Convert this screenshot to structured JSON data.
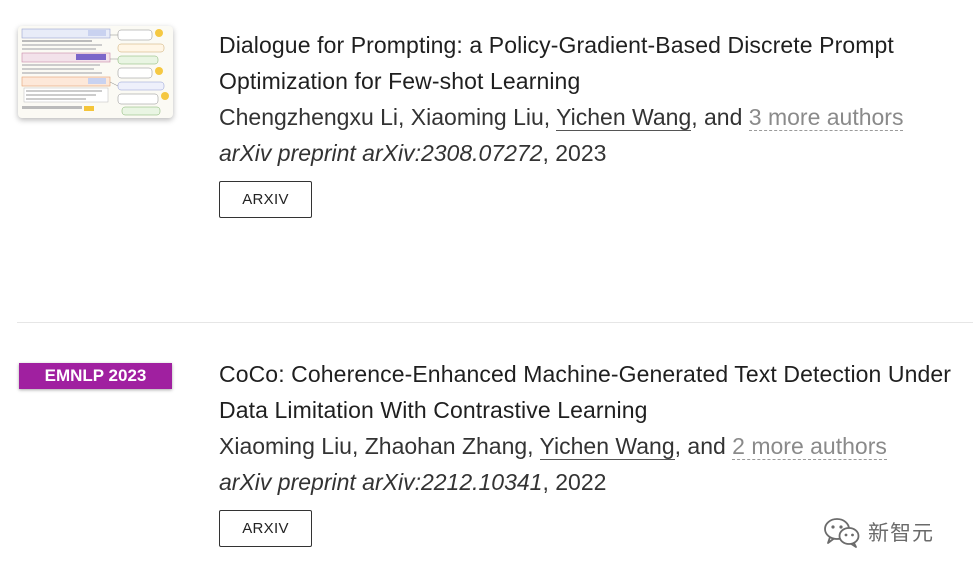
{
  "publications": [
    {
      "title": "Dialogue for Prompting: a Policy-Gradient-Based Discrete Prompt Optimization for Few-shot Learning",
      "authors_lead": "Chengzhengxu Li, Xiaoming Liu, ",
      "author_self": "Yichen Wang",
      "authors_and": ", and ",
      "more_authors": "3 more authors",
      "venue": "arXiv preprint arXiv:2308.07272",
      "year_suffix": ", 2023",
      "link_label": "ARXIV",
      "has_thumbnail": true
    },
    {
      "badge": "EMNLP 2023",
      "badge_color": "#a020a0",
      "title": "CoCo: Coherence-Enhanced Machine-Generated Text Detection Under Data Limitation With Contrastive Learning",
      "authors_lead": "Xiaoming Liu, Zhaohan Zhang, ",
      "author_self": "Yichen Wang",
      "authors_and": ", and ",
      "more_authors": "2 more authors",
      "venue": "arXiv preprint arXiv:2212.10341",
      "year_suffix": ", 2022",
      "link_label": "ARXIV"
    }
  ],
  "watermark": {
    "text": "新智元",
    "icon": "wechat-icon"
  }
}
